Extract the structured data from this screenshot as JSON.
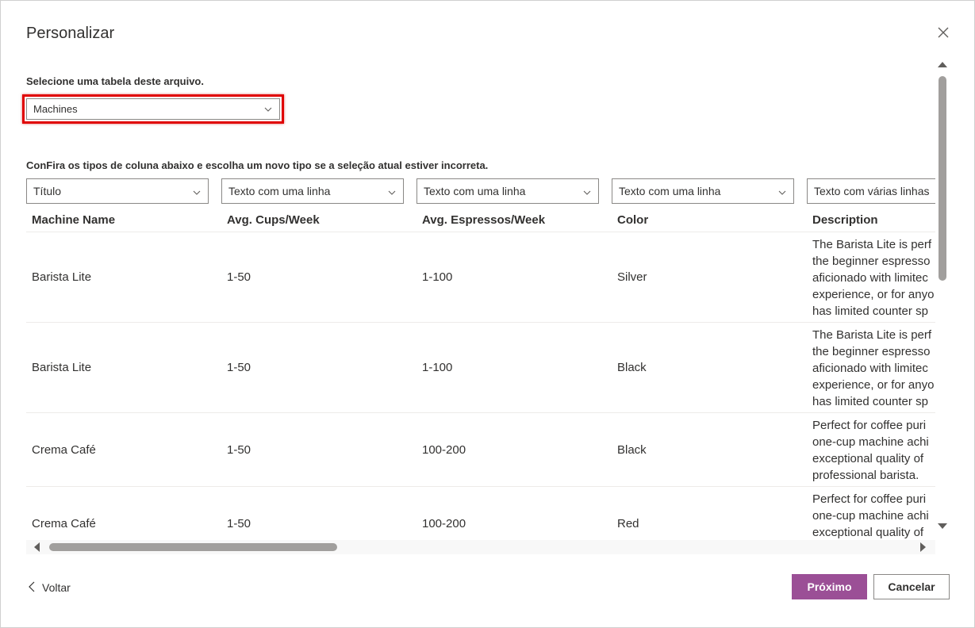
{
  "dialog": {
    "title": "Personalizar",
    "close_icon": "close-icon"
  },
  "table_picker": {
    "label": "Selecione uma tabela deste arquivo.",
    "selected": "Machines",
    "highlight_color": "#e00000"
  },
  "columns_section": {
    "label": "ConFira os tipos de coluna abaixo e escolha um novo tipo se a seleção atual estiver incorreta.",
    "types": [
      "Título",
      "Texto com uma linha",
      "Texto com uma linha",
      "Texto com uma linha",
      "Texto com várias linhas"
    ],
    "headers": [
      "Machine Name",
      "Avg. Cups/Week",
      "Avg. Espressos/Week",
      "Color",
      "Description"
    ]
  },
  "rows": [
    {
      "name": "Barista Lite",
      "cups": "1-50",
      "espressos": "1-100",
      "color": "Silver",
      "description": [
        "The Barista Lite is perf",
        "the beginner espresso",
        "aficionado with limitec",
        "experience, or for anyo",
        "has limited counter sp"
      ]
    },
    {
      "name": "Barista Lite",
      "cups": "1-50",
      "espressos": "1-100",
      "color": "Black",
      "description": [
        "The Barista Lite is perf",
        "the beginner espresso",
        "aficionado with limitec",
        "experience, or for anyo",
        "has limited counter sp"
      ]
    },
    {
      "name": "Crema Café",
      "cups": "1-50",
      "espressos": "100-200",
      "color": "Black",
      "description": [
        "Perfect for coffee puri",
        "one-cup machine achi",
        "exceptional quality of",
        "professional barista."
      ]
    },
    {
      "name": "Crema Café",
      "cups": "1-50",
      "espressos": "100-200",
      "color": "Red",
      "description": [
        "Perfect for coffee puri",
        "one-cup machine achi",
        "exceptional quality of"
      ]
    }
  ],
  "footer": {
    "back_label": "Voltar",
    "next_label": "Próximo",
    "cancel_label": "Cancelar",
    "accent_color": "#9b4f96"
  }
}
